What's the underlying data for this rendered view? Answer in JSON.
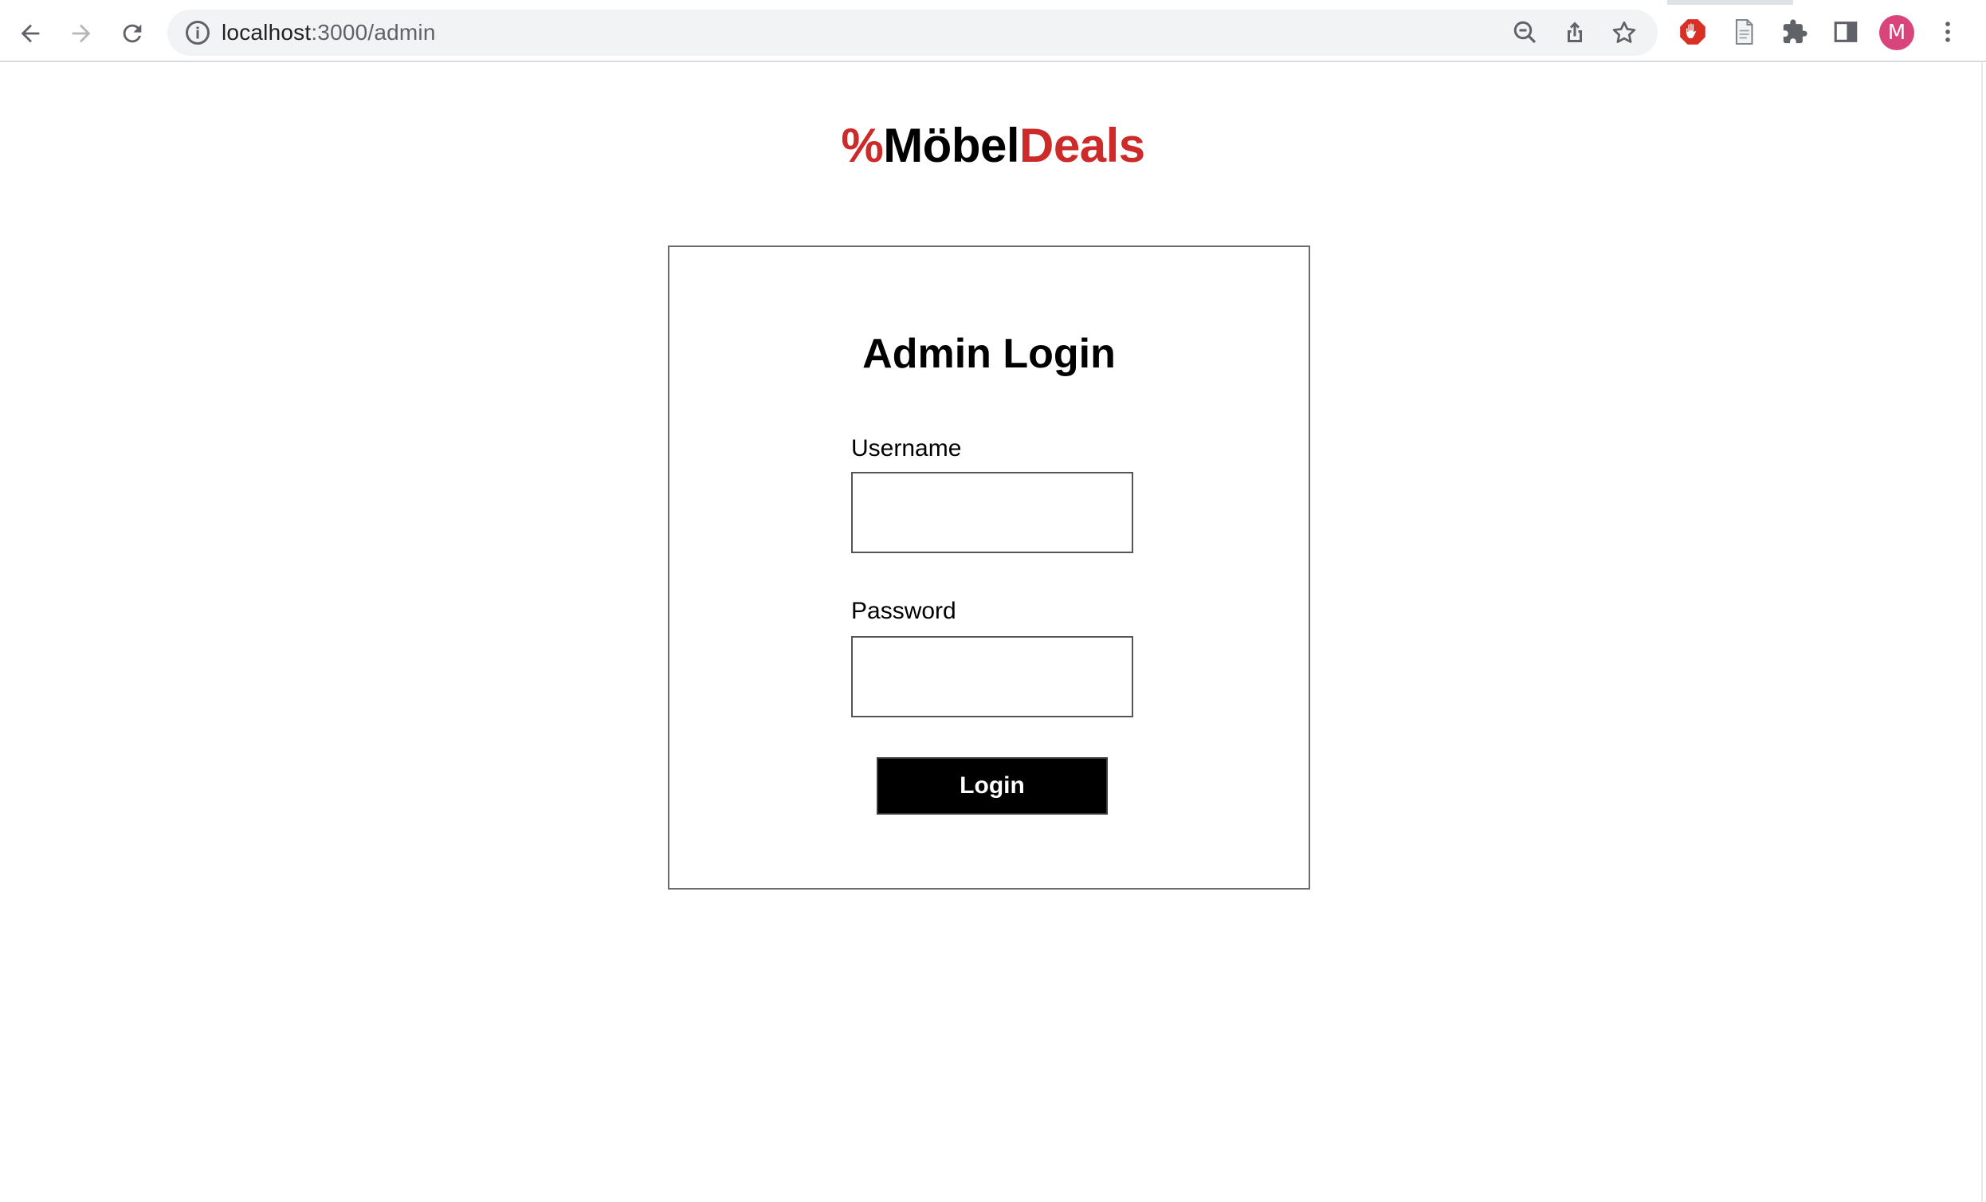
{
  "browser": {
    "url_host": "localhost",
    "url_path": ":3000/admin",
    "profile_initial": "M",
    "icons": {
      "back": "back-arrow-icon",
      "forward": "forward-arrow-icon",
      "reload": "reload-icon",
      "site_info": "info-icon",
      "zoom": "zoom-out-icon",
      "share": "share-icon",
      "bookmark": "star-icon",
      "adblock": "adblock-hand-icon",
      "reader": "document-icon",
      "extensions": "puzzle-icon",
      "side_panel": "side-panel-icon",
      "menu": "kebab-menu-icon"
    },
    "colors": {
      "avatar": "#d9457a",
      "adblock": "#d93025"
    }
  },
  "logo": {
    "symbol": "%",
    "part1": "Möbel",
    "part2": "Deals",
    "accent_color": "#cd2a2a"
  },
  "login": {
    "title": "Admin Login",
    "username_label": "Username",
    "username_value": "",
    "password_label": "Password",
    "password_value": "",
    "submit_label": "Login"
  }
}
